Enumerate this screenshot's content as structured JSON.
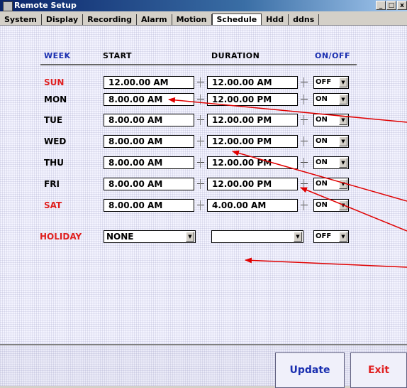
{
  "window": {
    "title": "Remote Setup",
    "buttons": [
      "_",
      "□",
      "x"
    ]
  },
  "tabs": [
    {
      "label": "System"
    },
    {
      "label": "Display"
    },
    {
      "label": "Recording"
    },
    {
      "label": "Alarm"
    },
    {
      "label": "Motion"
    },
    {
      "label": "Schedule",
      "active": true
    },
    {
      "label": "Hdd"
    },
    {
      "label": "ddns"
    }
  ],
  "headers": {
    "week": "WEEK",
    "start": "START",
    "duration": "DURATION",
    "onoff": "ON/OFF"
  },
  "schedule": [
    {
      "day": "SUN",
      "red": true,
      "start": "12.00.00 AM",
      "duration": "12.00.00 AM",
      "status": "OFF"
    },
    {
      "day": "MON",
      "red": false,
      "start": "8.00.00 AM",
      "duration": "12.00.00 PM",
      "status": "ON"
    },
    {
      "day": "TUE",
      "red": false,
      "start": "8.00.00 AM",
      "duration": "12.00.00 PM",
      "status": "ON"
    },
    {
      "day": "WED",
      "red": false,
      "start": "8.00.00 AM",
      "duration": "12.00.00 PM",
      "status": "ON"
    },
    {
      "day": "THU",
      "red": false,
      "start": "8.00.00 AM",
      "duration": "12.00.00 PM",
      "status": "ON"
    },
    {
      "day": "FRI",
      "red": false,
      "start": "8.00.00 AM",
      "duration": "12.00.00 PM",
      "status": "ON"
    },
    {
      "day": "SAT",
      "red": true,
      "start": "8.00.00 AM",
      "duration": "4.00.00 AM",
      "status": "ON"
    }
  ],
  "holiday": {
    "label": "HOLIDAY",
    "start": "NONE",
    "duration": "",
    "status": "OFF"
  },
  "footer": {
    "update_label": "Update",
    "exit_label": "Exit"
  },
  "colors": {
    "accent_red": "#e02020",
    "header_blue": "#1a2fb0",
    "arrow_red": "#e00000"
  }
}
